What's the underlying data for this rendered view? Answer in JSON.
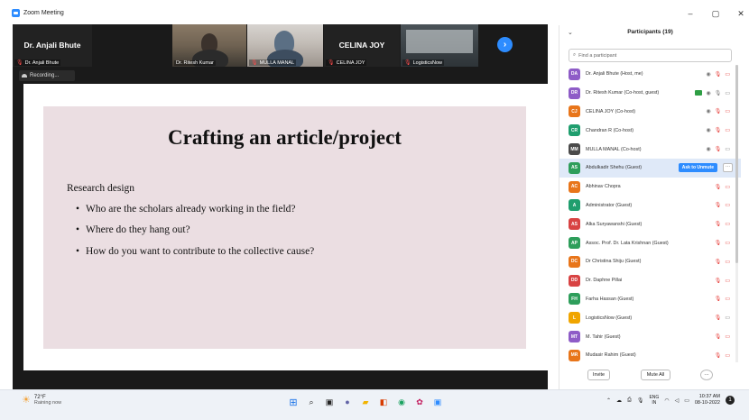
{
  "window": {
    "title": "Zoom Meeting",
    "controls": {
      "minimize": "–",
      "restore": "▢",
      "close": "✕"
    }
  },
  "video_strip": {
    "tiles": [
      {
        "big_name": "Dr. Anjali Bhute",
        "label": "Dr. Anjali Bhute",
        "muted": true,
        "video": false
      },
      {
        "big_name": "",
        "label": "Dr. Ritesh Kumar",
        "muted": false,
        "video": true
      },
      {
        "big_name": "",
        "label": "MULLA MANAL",
        "muted": true,
        "video": true
      },
      {
        "big_name": "CELINA JOY",
        "label": "CELINA JOY",
        "muted": true,
        "video": false
      },
      {
        "big_name": "",
        "label": "LogisticsNow",
        "muted": true,
        "video": true
      }
    ],
    "next_icon": "chevron-right-icon"
  },
  "recording": {
    "label": "Recording..."
  },
  "slide": {
    "title": "Crafting an article/project",
    "subtitle": "Research design",
    "bullets": [
      "Who are the scholars already working in the field?",
      "Where do they hang out?",
      "How do you want to contribute to the collective cause?"
    ]
  },
  "participants": {
    "header": "Participants (19)",
    "search_placeholder": "Find a participant",
    "ask_to_unmute": "Ask to Unmute",
    "rows": [
      {
        "initials": "DA",
        "color": "#8e5cc7",
        "name": "Dr. Anjali Bhute (Host, me)",
        "icons": [
          "eye",
          "mic-off",
          "cam-off"
        ]
      },
      {
        "initials": "DR",
        "color": "#8e5cc7",
        "name": "Dr. Ritesh Kumar (Co-host, guest)",
        "icons": [
          "green",
          "eye",
          "mic-on",
          "cam-on"
        ]
      },
      {
        "initials": "CJ",
        "color": "#e8751a",
        "name": "CELINA JOY (Co-host)",
        "icons": [
          "eye",
          "mic-off",
          "cam-off"
        ]
      },
      {
        "initials": "CR",
        "color": "#1f9e6e",
        "name": "Chandran R (Co-host)",
        "icons": [
          "eye",
          "mic-off",
          "cam-off"
        ]
      },
      {
        "initials": "MM",
        "color": "#4a4a4a",
        "name": "MULLA MANAL (Co-host)",
        "icons": [
          "eye",
          "mic-off",
          "cam-on"
        ]
      },
      {
        "initials": "AS",
        "color": "#2e9e5b",
        "name": "Abdulkadir Shehu (Guest)",
        "icons": [],
        "selected": true
      },
      {
        "initials": "AC",
        "color": "#e8751a",
        "name": "Abhinav Chopra",
        "icons": [
          "mic-off",
          "cam-off"
        ]
      },
      {
        "initials": "A",
        "color": "#1f9e6e",
        "name": "Administrator (Guest)",
        "icons": [
          "mic-off",
          "cam-off"
        ]
      },
      {
        "initials": "AS",
        "color": "#d84343",
        "name": "Alka Suryawanshi (Guest)",
        "icons": [
          "mic-off",
          "cam-off"
        ]
      },
      {
        "initials": "AP",
        "color": "#2e9e5b",
        "name": "Assoc. Prof. Dr. Lata Krishnan (Guest)",
        "icons": [
          "mic-off",
          "cam-off"
        ]
      },
      {
        "initials": "DC",
        "color": "#e8751a",
        "name": "Dr Christina Shiju (Guest)",
        "icons": [
          "mic-off",
          "cam-off"
        ]
      },
      {
        "initials": "DD",
        "color": "#d84343",
        "name": "Dr. Daphne Pillai",
        "icons": [
          "mic-off",
          "cam-off"
        ]
      },
      {
        "initials": "FH",
        "color": "#2e9e5b",
        "name": "Farha Hassan (Guest)",
        "icons": [
          "mic-off",
          "cam-off"
        ]
      },
      {
        "initials": "L",
        "color": "#f0a500",
        "name": "LogisticsNow (Guest)",
        "icons": [
          "mic-off",
          "cam-on"
        ]
      },
      {
        "initials": "MT",
        "color": "#8e5cc7",
        "name": "M. Tahir (Guest)",
        "icons": [
          "mic-off",
          "cam-off"
        ]
      },
      {
        "initials": "MR",
        "color": "#e8751a",
        "name": "Mudasir Rahim (Guest)",
        "icons": [
          "mic-off",
          "cam-off"
        ]
      }
    ],
    "footer": {
      "invite": "Invite",
      "mute_all": "Mute All",
      "more": "···"
    }
  },
  "taskbar": {
    "weather_temp": "72°F",
    "weather_desc": "Raining now",
    "apps": [
      "windows-icon",
      "search-icon",
      "task-view-icon",
      "chat-icon",
      "file-explorer-icon",
      "office-icon",
      "chrome-icon",
      "photos-icon",
      "zoom-icon"
    ],
    "lang_top": "ENG",
    "lang_bottom": "IN",
    "time": "10:37 AM",
    "date": "08-10-2022",
    "notification_count": "1"
  }
}
